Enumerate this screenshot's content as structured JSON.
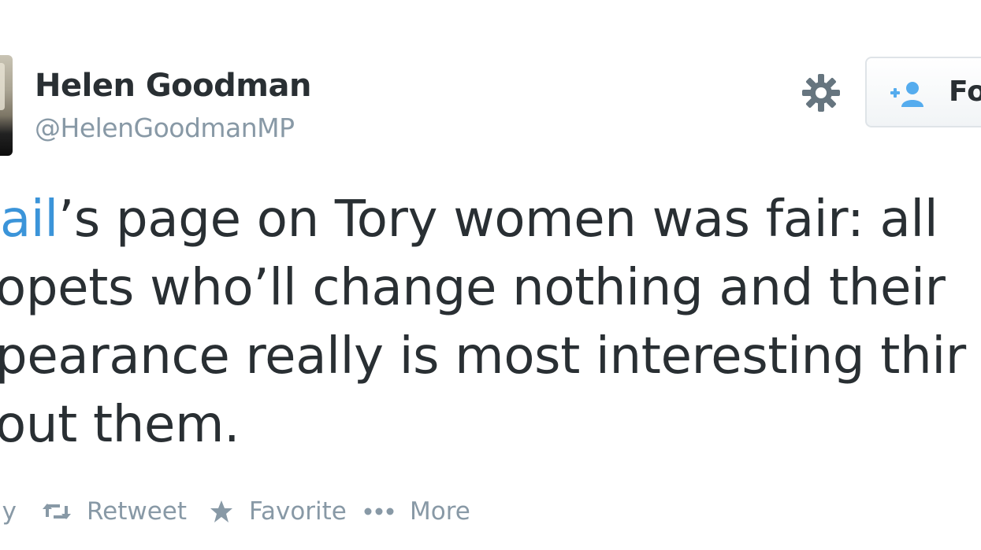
{
  "author": {
    "name": "Helen Goodman",
    "handle": "@HelenGoodmanMP"
  },
  "follow_button": {
    "label": "Fo"
  },
  "tweet": {
    "mention": "ail",
    "lines": [
      "’s page on Tory women was fair: all",
      "opets who’ll change nothing and their",
      "pearance really is most interesting thir",
      "out them."
    ]
  },
  "actions": {
    "reply": "ly",
    "retweet": "Retweet",
    "favorite": "Favorite",
    "more": "More"
  },
  "colors": {
    "text": "#292f33",
    "muted": "#8899a6",
    "link": "#3b94d9",
    "follow_icon": "#55acee"
  }
}
